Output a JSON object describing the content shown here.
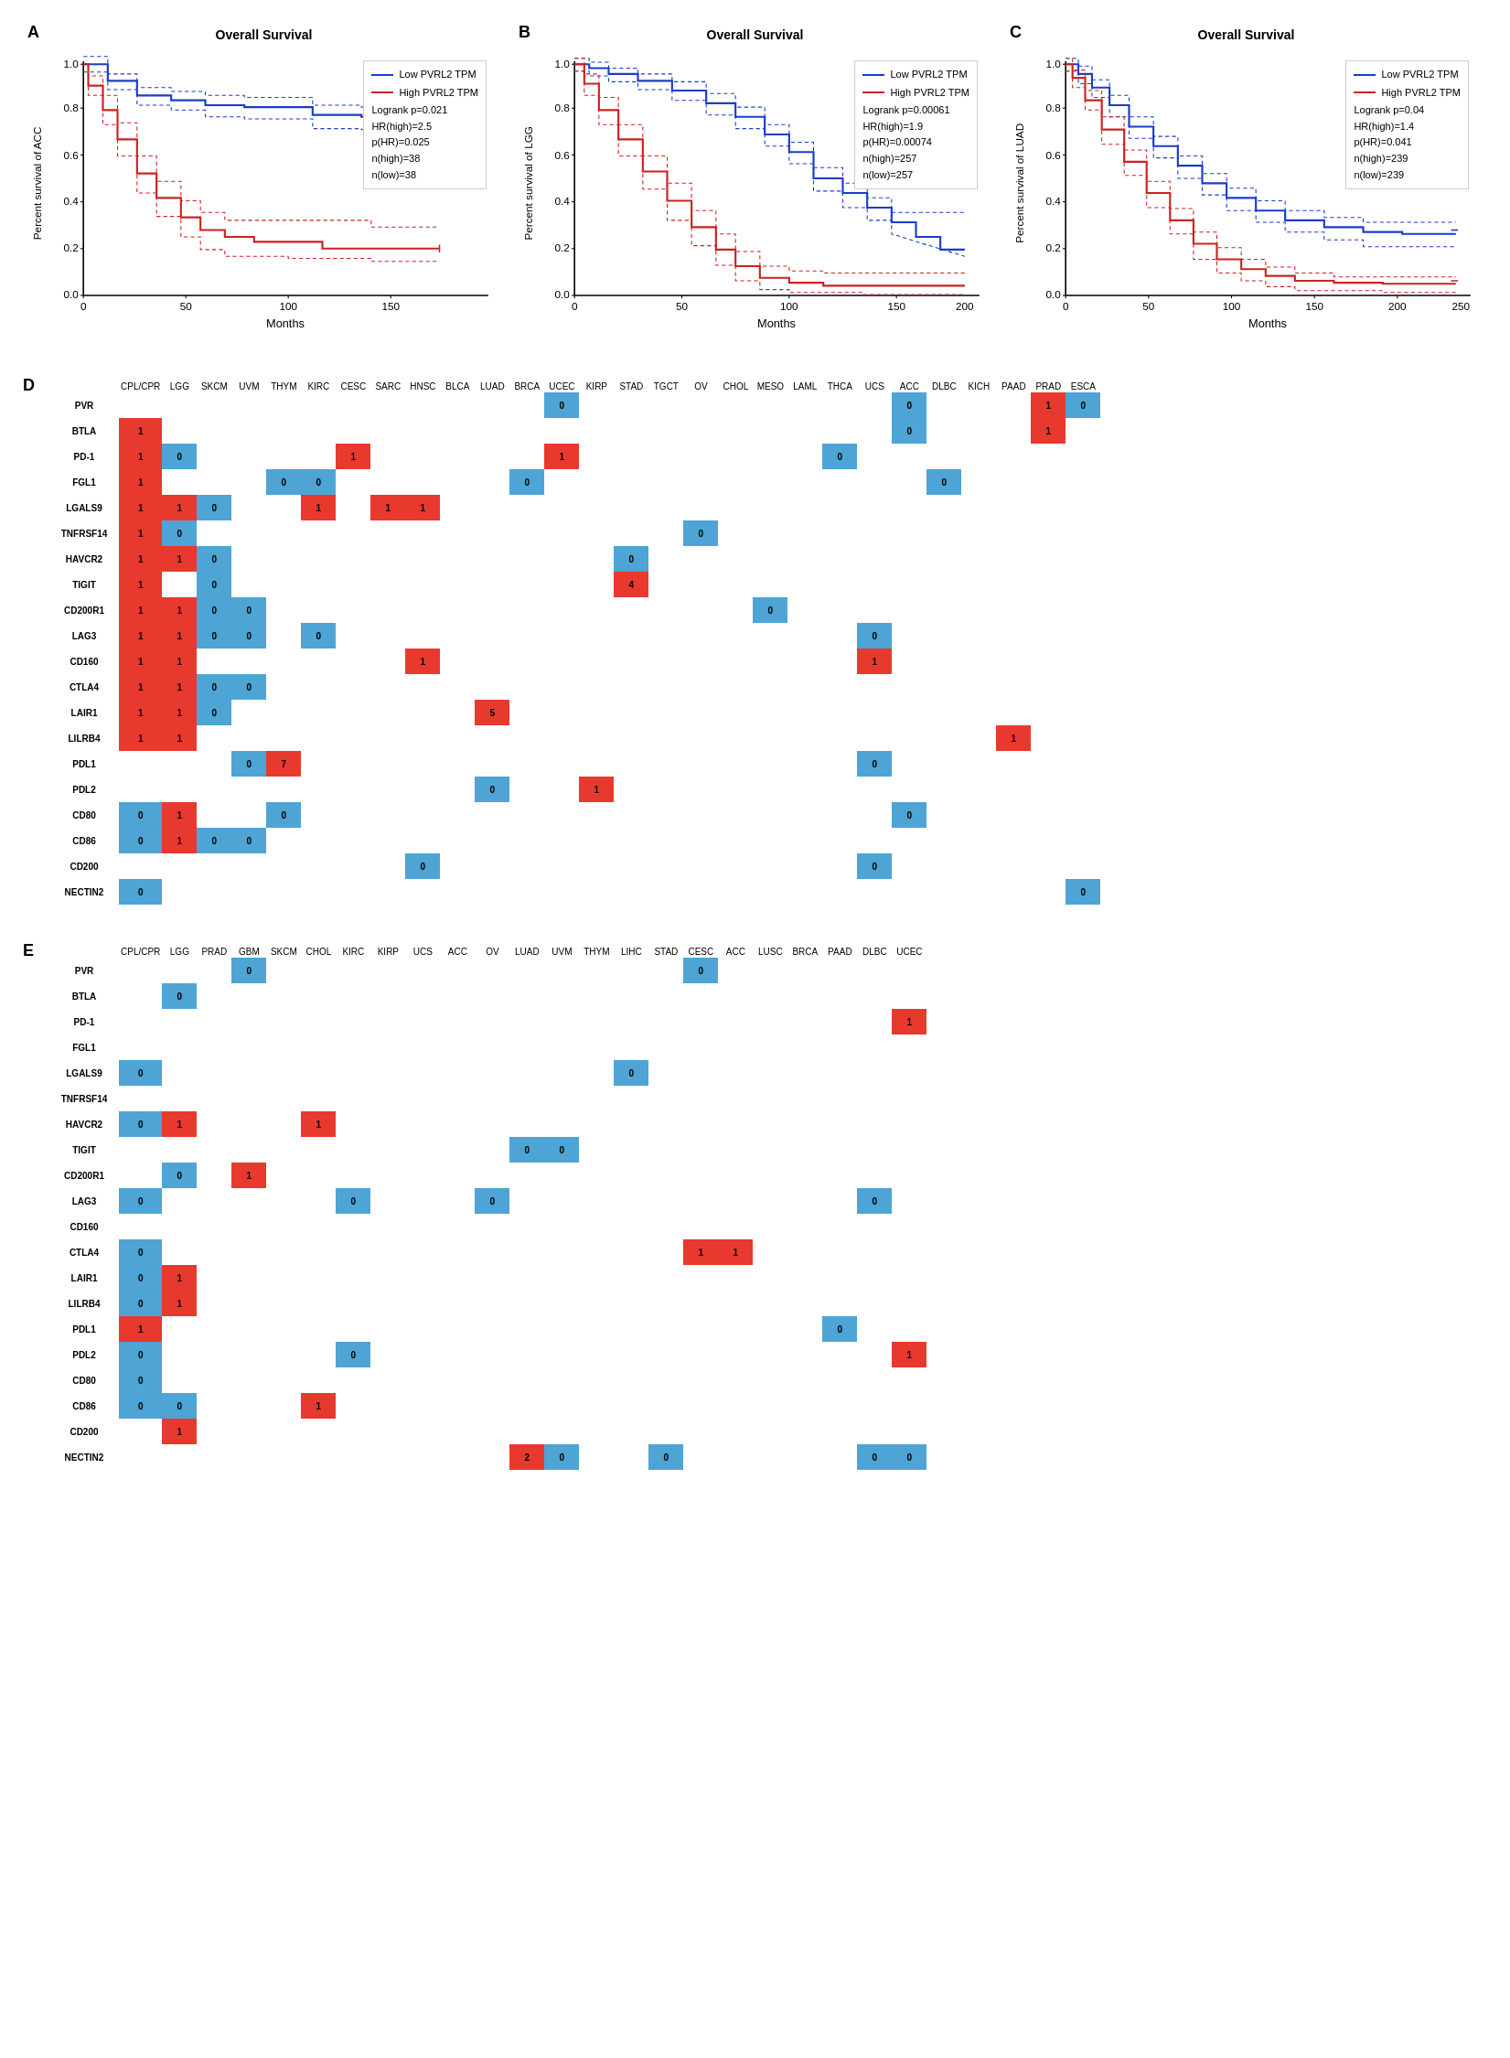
{
  "panels": {
    "A": {
      "label": "A",
      "title": "Overall Survival",
      "y_label": "Percent survival of ACC",
      "x_label": "Months",
      "x_max": 160,
      "legend": {
        "low": "Low PVRL2 TPM",
        "high": "High PVRL2 TPM",
        "logrank": "Logrank p=0.021",
        "hr": "HR(high)=2.5",
        "phr": "p(HR)=0.025",
        "nhigh": "n(high)=38",
        "nlow": "n(low)=38"
      }
    },
    "B": {
      "label": "B",
      "title": "Overall Survival",
      "y_label": "Percent survival of LGG",
      "x_label": "Months",
      "x_max": 200,
      "legend": {
        "low": "Low PVRL2 TPM",
        "high": "High PVRL2 TPM",
        "logrank": "Logrank p=0.00061",
        "hr": "HR(high)=1.9",
        "phr": "p(HR)=0.00074",
        "nhigh": "n(high)=257",
        "nlow": "n(low)=257"
      }
    },
    "C": {
      "label": "C",
      "title": "Overall Survival",
      "y_label": "Percent survival of LUAD",
      "x_label": "Months",
      "x_max": 250,
      "legend": {
        "low": "Low PVRL2 TPM",
        "high": "High PVRL2 TPM",
        "logrank": "Logrank p=0.04",
        "hr": "HR(high)=1.4",
        "phr": "p(HR)=0.041",
        "nhigh": "n(high)=239",
        "nlow": "n(low)=239"
      }
    }
  },
  "heatmap_D": {
    "label": "D",
    "columns": [
      "CPL/CPR",
      "LGG",
      "SKCM",
      "UVM",
      "THYM",
      "KIRC",
      "CESC",
      "SARC",
      "HNSC",
      "BLCA",
      "LUAD",
      "BRCA",
      "UCEC",
      "KIRP",
      "STAD",
      "TGCT",
      "OV",
      "CHOL",
      "MESO",
      "LAML",
      "THCA",
      "UCS",
      "ACC",
      "DLBC",
      "KICH",
      "PAAD",
      "PRAD",
      "ESCA"
    ],
    "rows": [
      {
        "gene": "PVR",
        "cells": [
          "",
          "",
          "",
          "",
          "",
          "",
          "",
          "",
          "",
          "",
          "",
          "",
          "0",
          "",
          "",
          "",
          "",
          "",
          "",
          "",
          "",
          "",
          "0",
          "",
          "",
          "",
          "1",
          "0"
        ]
      },
      {
        "gene": "BTLA",
        "cells": [
          "1",
          "",
          "",
          "",
          "",
          "",
          "",
          "",
          "",
          "",
          "",
          "",
          "",
          "",
          "",
          "",
          "",
          "",
          "",
          "",
          "",
          "",
          "0",
          "",
          "",
          "",
          "1",
          ""
        ]
      },
      {
        "gene": "PD-1",
        "cells": [
          "1",
          "0",
          "",
          "",
          "",
          "",
          "1",
          "",
          "",
          "",
          "",
          "",
          "1",
          "",
          "",
          "",
          "",
          "",
          "",
          "",
          "0",
          "",
          "",
          "",
          "",
          "",
          "",
          ""
        ]
      },
      {
        "gene": "FGL1",
        "cells": [
          "1",
          "",
          "",
          "",
          "0",
          "0",
          "",
          "",
          "",
          "",
          "",
          "0",
          "",
          "",
          "",
          "",
          "",
          "",
          "",
          "",
          "",
          "",
          "",
          "0",
          "",
          "",
          "",
          ""
        ]
      },
      {
        "gene": "LGALS9",
        "cells": [
          "1",
          "1",
          "0",
          "",
          "",
          "1",
          "",
          "1",
          "1",
          "",
          "",
          "",
          "",
          "",
          "",
          "",
          "",
          "",
          "",
          "",
          "",
          "",
          "",
          "",
          "",
          "",
          "",
          ""
        ]
      },
      {
        "gene": "TNFRSF14",
        "cells": [
          "1",
          "0",
          "",
          "",
          "",
          "",
          "",
          "",
          "",
          "",
          "",
          "",
          "",
          "",
          "",
          "",
          "0",
          "",
          "",
          "",
          "",
          "",
          "",
          "",
          "",
          "",
          "",
          ""
        ]
      },
      {
        "gene": "HAVCR2",
        "cells": [
          "1",
          "1",
          "0",
          "",
          "",
          "",
          "",
          "",
          "",
          "",
          "",
          "",
          "",
          "",
          "0",
          "",
          "",
          "",
          "",
          "",
          "",
          "",
          "",
          "",
          "",
          "",
          "",
          ""
        ]
      },
      {
        "gene": "TIGIT",
        "cells": [
          "1",
          "",
          "0",
          "",
          "",
          "",
          "",
          "",
          "",
          "",
          "",
          "",
          "",
          "",
          "4",
          "",
          "",
          "",
          "",
          "",
          "",
          "",
          "",
          "",
          "",
          "",
          "",
          ""
        ]
      },
      {
        "gene": "CD200R1",
        "cells": [
          "1",
          "1",
          "0",
          "0",
          "",
          "",
          "",
          "",
          "",
          "",
          "",
          "",
          "",
          "",
          "",
          "",
          "",
          "",
          "0",
          "",
          "",
          "",
          "",
          "",
          "",
          "",
          "",
          ""
        ]
      },
      {
        "gene": "LAG3",
        "cells": [
          "1",
          "1",
          "0",
          "0",
          "",
          "0",
          "",
          "",
          "",
          "",
          "",
          "",
          "",
          "",
          "",
          "",
          "",
          "",
          "",
          "",
          "",
          "0",
          "",
          "",
          "",
          "",
          "",
          ""
        ]
      },
      {
        "gene": "CD160",
        "cells": [
          "1",
          "1",
          "",
          "",
          "",
          "",
          "",
          "",
          "1",
          "",
          "",
          "",
          "",
          "",
          "",
          "",
          "",
          "",
          "",
          "",
          "",
          "1",
          "",
          "",
          "",
          "",
          "",
          ""
        ]
      },
      {
        "gene": "CTLA4",
        "cells": [
          "1",
          "1",
          "0",
          "0",
          "",
          "",
          "",
          "",
          "",
          "",
          "",
          "",
          "",
          "",
          "",
          "",
          "",
          "",
          "",
          "",
          "",
          "",
          "",
          "",
          "",
          "",
          "",
          ""
        ]
      },
      {
        "gene": "LAIR1",
        "cells": [
          "1",
          "1",
          "0",
          "",
          "",
          "",
          "",
          "",
          "",
          "",
          "5",
          "",
          "",
          "",
          "",
          "",
          "",
          "",
          "",
          "",
          "",
          "",
          "",
          "",
          "",
          "",
          "",
          ""
        ]
      },
      {
        "gene": "LILRB4",
        "cells": [
          "1",
          "1",
          "",
          "",
          "",
          "",
          "",
          "",
          "",
          "",
          "",
          "",
          "",
          "",
          "",
          "",
          "",
          "",
          "",
          "",
          "",
          "",
          "",
          "",
          "",
          "1",
          "",
          ""
        ]
      },
      {
        "gene": "PDL1",
        "cells": [
          "",
          "",
          "",
          "0",
          "7",
          "",
          "",
          "",
          "",
          "",
          "",
          "",
          "",
          "",
          "",
          "",
          "",
          "",
          "",
          "",
          "",
          "0",
          "",
          "",
          "",
          "",
          "",
          ""
        ]
      },
      {
        "gene": "PDL2",
        "cells": [
          "",
          "",
          "",
          "",
          "",
          "",
          "",
          "",
          "",
          "",
          "0",
          "",
          "",
          "1",
          "",
          "",
          "",
          "",
          "",
          "",
          "",
          "",
          "",
          "",
          "",
          "",
          "",
          ""
        ]
      },
      {
        "gene": "CD80",
        "cells": [
          "0",
          "1",
          "",
          "",
          "0",
          "",
          "",
          "",
          "",
          "",
          "",
          "",
          "",
          "",
          "",
          "",
          "",
          "",
          "",
          "",
          "",
          "",
          "0",
          "",
          "",
          "",
          "",
          ""
        ]
      },
      {
        "gene": "CD86",
        "cells": [
          "0",
          "1",
          "0",
          "0",
          "",
          "",
          "",
          "",
          "",
          "",
          "",
          "",
          "",
          "",
          "",
          "",
          "",
          "",
          "",
          "",
          "",
          "",
          "",
          "",
          "",
          "",
          "",
          ""
        ]
      },
      {
        "gene": "CD200",
        "cells": [
          "",
          "",
          "",
          "",
          "",
          "",
          "",
          "",
          "0",
          "",
          "",
          "",
          "",
          "",
          "",
          "",
          "",
          "",
          "",
          "",
          "",
          "0",
          "",
          "",
          "",
          "",
          "",
          ""
        ]
      },
      {
        "gene": "NECTIN2",
        "cells": [
          "0",
          "",
          "",
          "",
          "",
          "",
          "",
          "",
          "",
          "",
          "",
          "",
          "",
          "",
          "",
          "",
          "",
          "",
          "",
          "",
          "",
          "",
          "",
          "",
          "",
          "",
          "",
          "0"
        ]
      }
    ]
  },
  "heatmap_E": {
    "label": "E",
    "columns": [
      "CPL/CPR",
      "LGG",
      "PRAD",
      "GBM",
      "SKCM",
      "CHOL",
      "KIRC",
      "KIRP",
      "UCS",
      "ACC",
      "OV",
      "LUAD",
      "UVM",
      "THYM",
      "LIHC",
      "STAD",
      "CESC",
      "ACC",
      "LUSC",
      "BRCA",
      "PAAD",
      "DLBC",
      "UCEC"
    ],
    "rows": [
      {
        "gene": "PVR",
        "cells": [
          "",
          "",
          "",
          "0",
          "",
          "",
          "",
          "",
          "",
          "",
          "",
          "",
          "",
          "",
          "",
          "",
          "0",
          "",
          "",
          "",
          "",
          "",
          ""
        ]
      },
      {
        "gene": "BTLA",
        "cells": [
          "",
          "0",
          "",
          "",
          "",
          "",
          "",
          "",
          "",
          "",
          "",
          "",
          "",
          "",
          "",
          "",
          "",
          "",
          "",
          "",
          "",
          "",
          ""
        ]
      },
      {
        "gene": "PD-1",
        "cells": [
          "",
          "",
          "",
          "",
          "",
          "",
          "",
          "",
          "",
          "",
          "",
          "",
          "",
          "",
          "",
          "",
          "",
          "",
          "",
          "",
          "",
          "",
          "1"
        ]
      },
      {
        "gene": "FGL1",
        "cells": [
          "",
          "",
          "",
          "",
          "",
          "",
          "",
          "",
          "",
          "",
          "",
          "",
          "",
          "",
          "",
          "",
          "",
          "",
          "",
          "",
          "",
          "",
          ""
        ]
      },
      {
        "gene": "LGALS9",
        "cells": [
          "0",
          "",
          "",
          "",
          "",
          "",
          "",
          "",
          "",
          "",
          "",
          "",
          "",
          "",
          "0",
          "",
          "",
          "",
          "",
          "",
          "",
          "",
          ""
        ]
      },
      {
        "gene": "TNFRSF14",
        "cells": [
          "",
          "",
          "",
          "",
          "",
          "",
          "",
          "",
          "",
          "",
          "",
          "",
          "",
          "",
          "",
          "",
          "",
          "",
          "",
          "",
          "",
          "",
          ""
        ]
      },
      {
        "gene": "HAVCR2",
        "cells": [
          "0",
          "1",
          "",
          "",
          "",
          "1",
          "",
          "",
          "",
          "",
          "",
          "",
          "",
          "",
          "",
          "",
          "",
          "",
          "",
          "",
          "",
          "",
          ""
        ]
      },
      {
        "gene": "TIGIT",
        "cells": [
          "",
          "",
          "",
          "",
          "",
          "",
          "",
          "",
          "",
          "",
          "",
          "0",
          "0",
          "",
          "",
          "",
          "",
          "",
          "",
          "",
          "",
          "",
          ""
        ]
      },
      {
        "gene": "CD200R1",
        "cells": [
          "",
          "0",
          "",
          "1",
          "",
          "",
          "",
          "",
          "",
          "",
          "",
          "",
          "",
          "",
          "",
          "",
          "",
          "",
          "",
          "",
          "",
          "",
          ""
        ]
      },
      {
        "gene": "LAG3",
        "cells": [
          "0",
          "",
          "",
          "",
          "",
          "",
          "0",
          "",
          "",
          "",
          "0",
          "",
          "",
          "",
          "",
          "",
          "",
          "",
          "",
          "",
          "",
          "0",
          ""
        ]
      },
      {
        "gene": "CD160",
        "cells": [
          "",
          "",
          "",
          "",
          "",
          "",
          "",
          "",
          "",
          "",
          "",
          "",
          "",
          "",
          "",
          "",
          "",
          "",
          "",
          "",
          "",
          "",
          ""
        ]
      },
      {
        "gene": "CTLA4",
        "cells": [
          "0",
          "",
          "",
          "",
          "",
          "",
          "",
          "",
          "",
          "",
          "",
          "",
          "",
          "",
          "",
          "",
          "1",
          "1",
          "",
          "",
          "",
          "",
          ""
        ]
      },
      {
        "gene": "LAIR1",
        "cells": [
          "0",
          "1",
          "",
          "",
          "",
          "",
          "",
          "",
          "",
          "",
          "",
          "",
          "",
          "",
          "",
          "",
          "",
          "",
          "",
          "",
          "",
          "",
          ""
        ]
      },
      {
        "gene": "LILRB4",
        "cells": [
          "0",
          "1",
          "",
          "",
          "",
          "",
          "",
          "",
          "",
          "",
          "",
          "",
          "",
          "",
          "",
          "",
          "",
          "",
          "",
          "",
          "",
          "",
          ""
        ]
      },
      {
        "gene": "PDL1",
        "cells": [
          "1",
          "",
          "",
          "",
          "",
          "",
          "",
          "",
          "",
          "",
          "",
          "",
          "",
          "",
          "",
          "",
          "",
          "",
          "",
          "",
          "0",
          "",
          ""
        ]
      },
      {
        "gene": "PDL2",
        "cells": [
          "0",
          "",
          "",
          "",
          "",
          "",
          "0",
          "",
          "",
          "",
          "",
          "",
          "",
          "",
          "",
          "",
          "",
          "",
          "",
          "",
          "",
          "",
          "1"
        ]
      },
      {
        "gene": "CD80",
        "cells": [
          "0",
          "",
          "",
          "",
          "",
          "",
          "",
          "",
          "",
          "",
          "",
          "",
          "",
          "",
          "",
          "",
          "",
          "",
          "",
          "",
          "",
          "",
          ""
        ]
      },
      {
        "gene": "CD86",
        "cells": [
          "0",
          "0",
          "",
          "",
          "",
          "1",
          "",
          "",
          "",
          "",
          "",
          "",
          "",
          "",
          "",
          "",
          "",
          "",
          "",
          "",
          "",
          "",
          ""
        ]
      },
      {
        "gene": "CD200",
        "cells": [
          "",
          "1",
          "",
          "",
          "",
          "",
          "",
          "",
          "",
          "",
          "",
          "",
          "",
          "",
          "",
          "",
          "",
          "",
          "",
          "",
          "",
          "",
          ""
        ]
      },
      {
        "gene": "NECTIN2",
        "cells": [
          "",
          "",
          "",
          "",
          "",
          "",
          "",
          "",
          "",
          "",
          "",
          "2",
          "0",
          "",
          "",
          "0",
          "",
          "",
          "",
          "",
          "",
          "0",
          "0"
        ]
      }
    ]
  },
  "colors": {
    "blue_line": "#1a3ccc",
    "red_line": "#cc2222",
    "cell_red": "#e8392e",
    "cell_blue": "#4ea4d4"
  }
}
